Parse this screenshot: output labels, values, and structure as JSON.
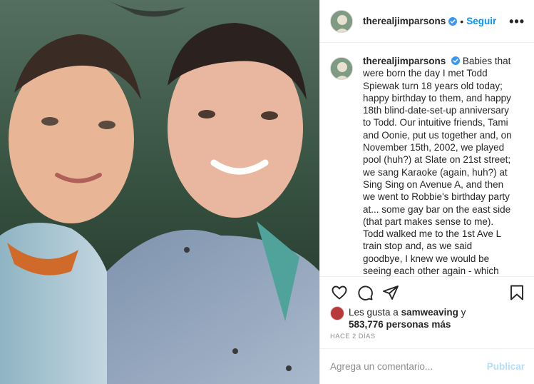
{
  "post": {
    "username": "therealjimparsons",
    "follow_label": "Seguir",
    "separator": "•",
    "more_label": "•••",
    "caption": "Babies that were born the day I met Todd Spiewak turn 18 years old today; happy birthday to them, and happy 18th blind-date-set-up anniversary to Todd. Our intuitive friends, Tami and Oonie, put us together and, on November 15th, 2002, we played pool (huh?) at Slate on 21st street; we sang Karaoke (again, huh?) at Sing Sing on Avenue A, and then we went to Robbie's birthday party at... some gay bar on the east side (that part makes sense to me). Todd walked me to the 1st Ave L train stop and, as we said goodbye, I knew we would be seeing each other again - which ended up being two nights later, when we went to see Michael Moore's \"Bowling for Columbine\"",
    "likes_prefix": "Les gusta a",
    "likes_user": "samweaving",
    "likes_conj": "y",
    "likes_count": "583,776 personas más",
    "timestamp": "HACE 2 DÍAS",
    "comment_placeholder": "Agrega un comentario...",
    "publish_label": "Publicar"
  },
  "icons": {
    "verified": "verified-badge-icon",
    "like": "heart-icon",
    "comment": "comment-bubble-icon",
    "share": "paper-plane-icon",
    "save": "bookmark-icon"
  },
  "colors": {
    "accent": "#0095f6",
    "publish_disabled": "#b2dffc",
    "muted": "#8e8e8e",
    "text": "#262626"
  }
}
